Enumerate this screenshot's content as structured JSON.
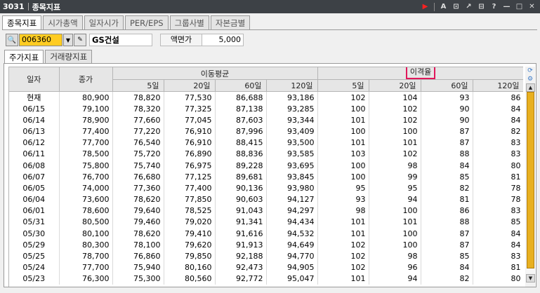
{
  "window": {
    "code": "3031",
    "title": "종목지표",
    "icons": [
      "play-icon",
      "font-icon",
      "new-window-icon",
      "pin-icon",
      "restore-icon",
      "help-icon",
      "minimize-icon",
      "maximize-icon",
      "close-icon"
    ],
    "glyphs": [
      "▶",
      "A",
      "⊡",
      "↗",
      "⊟",
      "?",
      "—",
      "□",
      "✕"
    ]
  },
  "tabs": [
    {
      "label": "종목지표",
      "active": true
    },
    {
      "label": "시가총액",
      "active": false
    },
    {
      "label": "일자시가",
      "active": false
    },
    {
      "label": "PER/EPS",
      "active": false
    },
    {
      "label": "그룹사별",
      "active": false
    },
    {
      "label": "자본금별",
      "active": false
    }
  ],
  "search": {
    "code": "006360",
    "name": "GS건설",
    "face_value_label": "액면가",
    "face_value": "5,000"
  },
  "subtabs": [
    {
      "label": "주가지표",
      "active": true
    },
    {
      "label": "거래량지표",
      "active": false
    }
  ],
  "table": {
    "col_date": "일자",
    "col_close": "종가",
    "group_ma": "이동평균",
    "group_dev": "이격율",
    "sub_headers": [
      "5일",
      "20일",
      "60일",
      "120일",
      "5일",
      "20일",
      "60일",
      "120일"
    ],
    "rows": [
      [
        "현재",
        "80,900",
        "78,820",
        "77,530",
        "86,688",
        "93,186",
        "102",
        "104",
        "93",
        "86"
      ],
      [
        "06/15",
        "79,100",
        "78,320",
        "77,325",
        "87,138",
        "93,285",
        "100",
        "102",
        "90",
        "84"
      ],
      [
        "06/14",
        "78,900",
        "77,660",
        "77,045",
        "87,603",
        "93,344",
        "101",
        "102",
        "90",
        "84"
      ],
      [
        "06/13",
        "77,400",
        "77,220",
        "76,910",
        "87,996",
        "93,409",
        "100",
        "100",
        "87",
        "82"
      ],
      [
        "06/12",
        "77,700",
        "76,540",
        "76,910",
        "88,415",
        "93,500",
        "101",
        "101",
        "87",
        "83"
      ],
      [
        "06/11",
        "78,500",
        "75,720",
        "76,890",
        "88,836",
        "93,585",
        "103",
        "102",
        "88",
        "83"
      ],
      [
        "06/08",
        "75,800",
        "75,740",
        "76,975",
        "89,228",
        "93,695",
        "100",
        "98",
        "84",
        "80"
      ],
      [
        "06/07",
        "76,700",
        "76,680",
        "77,125",
        "89,681",
        "93,845",
        "100",
        "99",
        "85",
        "81"
      ],
      [
        "06/05",
        "74,000",
        "77,360",
        "77,400",
        "90,136",
        "93,980",
        "95",
        "95",
        "82",
        "78"
      ],
      [
        "06/04",
        "73,600",
        "78,620",
        "77,850",
        "90,603",
        "94,127",
        "93",
        "94",
        "81",
        "78"
      ],
      [
        "06/01",
        "78,600",
        "79,640",
        "78,525",
        "91,043",
        "94,297",
        "98",
        "100",
        "86",
        "83"
      ],
      [
        "05/31",
        "80,500",
        "79,460",
        "79,020",
        "91,341",
        "94,434",
        "101",
        "101",
        "88",
        "85"
      ],
      [
        "05/30",
        "80,100",
        "78,620",
        "79,410",
        "91,616",
        "94,532",
        "101",
        "100",
        "87",
        "84"
      ],
      [
        "05/29",
        "80,300",
        "78,100",
        "79,620",
        "91,913",
        "94,649",
        "102",
        "100",
        "87",
        "84"
      ],
      [
        "05/25",
        "78,700",
        "76,860",
        "79,850",
        "92,188",
        "94,770",
        "102",
        "98",
        "85",
        "83"
      ],
      [
        "05/24",
        "77,700",
        "75,940",
        "80,160",
        "92,473",
        "94,905",
        "102",
        "96",
        "84",
        "81"
      ],
      [
        "05/23",
        "76,300",
        "75,300",
        "80,560",
        "92,772",
        "95,047",
        "101",
        "94",
        "82",
        "80"
      ]
    ]
  },
  "colors": {
    "titlebar": "#3d4146",
    "code_highlight": "#ffcc22",
    "header_highlight": "#e0185b",
    "scroll_thumb": "#e8b020"
  }
}
